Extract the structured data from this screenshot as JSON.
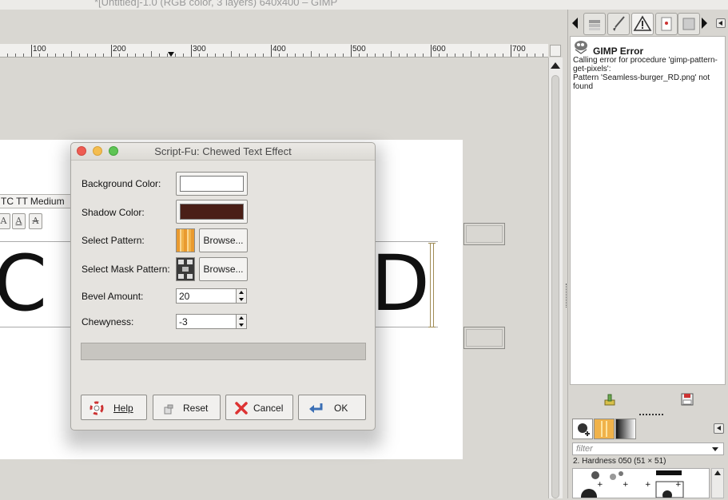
{
  "window": {
    "title": "*[Untitled]-1.0 (RGB color, 3 layers) 640x400 – GIMP"
  },
  "ruler": {
    "labels": [
      "100",
      "200",
      "300",
      "400",
      "500",
      "600",
      "700"
    ]
  },
  "canvas": {
    "text_left": "C",
    "text_right": "D",
    "font_name": "TC TT Medium",
    "style_buttons": [
      "A",
      "A",
      "A"
    ]
  },
  "dialog": {
    "title": "Script-Fu: Chewed Text Effect",
    "fields": {
      "background_color": {
        "label": "Background Color:",
        "value": "#ffffff"
      },
      "shadow_color": {
        "label": "Shadow Color:",
        "value": "#4a1f17"
      },
      "select_pattern": {
        "label": "Select Pattern:",
        "browse": "Browse..."
      },
      "select_mask_pattern": {
        "label": "Select Mask Pattern:",
        "browse": "Browse..."
      },
      "bevel_amount": {
        "label": "Bevel Amount:",
        "value": "20"
      },
      "chewyness": {
        "label": "Chewyness:",
        "value": "-3"
      }
    },
    "buttons": {
      "help": "Help",
      "reset": "Reset",
      "cancel": "Cancel",
      "ok": "OK"
    }
  },
  "error_console": {
    "title": "GIMP Error",
    "message": "Calling error for procedure 'gimp-pattern-\nget-pixels':\nPattern 'Seamless-burger_RD.png' not\nfound"
  },
  "brushes": {
    "filter_placeholder": "filter",
    "selected_brush": "2. Hardness 050 (51 × 51)"
  }
}
